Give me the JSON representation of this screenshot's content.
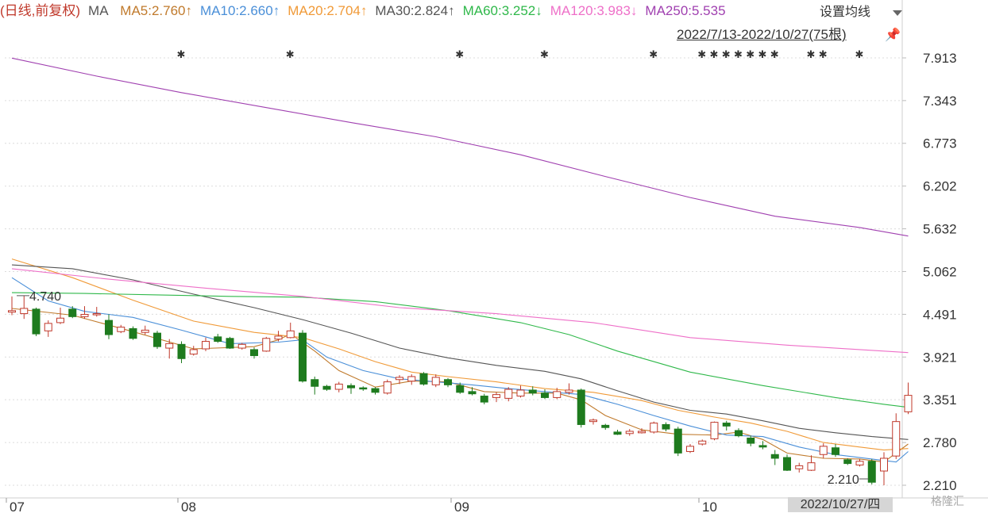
{
  "legend": {
    "title": "(日线,前复权)",
    "ma": "MA",
    "items": [
      {
        "label": "MA5:2.760↑",
        "color": "#c07a2c"
      },
      {
        "label": "MA10:2.660↑",
        "color": "#4a8fd8"
      },
      {
        "label": "MA20:2.704↑",
        "color": "#f09a38"
      },
      {
        "label": "MA30:2.824↑",
        "color": "#555555"
      },
      {
        "label": "MA60:3.252↓",
        "color": "#2fb84a"
      },
      {
        "label": "MA120:3.983↓",
        "color": "#ee6fc8"
      },
      {
        "label": "MA250:5.535",
        "color": "#a040b0"
      }
    ],
    "settings_label": "设置均线"
  },
  "range_label": "2022/7/13-2022/10/27(75根)",
  "date_box": "2022/10/27/四",
  "logo": "格隆汇",
  "chart_data": {
    "type": "candlestick",
    "y_ticks": [
      "7.913",
      "7.343",
      "6.773",
      "6.202",
      "5.632",
      "5.062",
      "4.491",
      "3.921",
      "3.351",
      "2.780",
      "2.210"
    ],
    "ylim": [
      2.21,
      7.913
    ],
    "x_ticks": [
      "07",
      "08",
      "09",
      "10"
    ],
    "annotations": [
      {
        "text": "4.740",
        "index": 0,
        "value": 4.74
      },
      {
        "text": "2.210",
        "index": 71,
        "value": 2.21
      }
    ],
    "event_markers": [
      14,
      23,
      37,
      44,
      53,
      57,
      58,
      59,
      60,
      61,
      62,
      63,
      66,
      67,
      70
    ],
    "candles": [
      [
        4.52,
        4.54,
        4.73,
        4.48
      ],
      [
        4.5,
        4.57,
        4.74,
        4.43
      ],
      [
        4.56,
        4.23,
        4.58,
        4.2
      ],
      [
        4.27,
        4.37,
        4.41,
        4.19
      ],
      [
        4.38,
        4.44,
        4.58,
        4.36
      ],
      [
        4.56,
        4.46,
        4.6,
        4.44
      ],
      [
        4.46,
        4.49,
        4.6,
        4.43
      ],
      [
        4.49,
        4.5,
        4.59,
        4.46
      ],
      [
        4.41,
        4.22,
        4.49,
        4.16
      ],
      [
        4.26,
        4.32,
        4.35,
        4.24
      ],
      [
        4.3,
        4.17,
        4.33,
        4.15
      ],
      [
        4.25,
        4.28,
        4.34,
        4.22
      ],
      [
        4.24,
        4.06,
        4.27,
        4.03
      ],
      [
        4.04,
        4.1,
        4.16,
        3.9
      ],
      [
        4.09,
        3.9,
        4.13,
        3.84
      ],
      [
        3.96,
        4.02,
        4.07,
        3.94
      ],
      [
        4.03,
        4.13,
        4.18,
        4.0
      ],
      [
        4.19,
        4.13,
        4.23,
        4.11
      ],
      [
        4.17,
        4.04,
        4.19,
        4.03
      ],
      [
        4.04,
        4.09,
        4.11,
        4.02
      ],
      [
        4.02,
        3.94,
        4.05,
        3.9
      ],
      [
        4.0,
        4.17,
        4.19,
        3.99
      ],
      [
        4.16,
        4.2,
        4.27,
        4.13
      ],
      [
        4.18,
        4.27,
        4.38,
        4.17
      ],
      [
        4.24,
        3.6,
        4.28,
        3.58
      ],
      [
        3.62,
        3.53,
        3.66,
        3.42
      ],
      [
        3.53,
        3.49,
        3.55,
        3.47
      ],
      [
        3.49,
        3.56,
        3.59,
        3.45
      ],
      [
        3.54,
        3.51,
        3.57,
        3.43
      ],
      [
        3.51,
        3.5,
        3.53,
        3.47
      ],
      [
        3.5,
        3.45,
        3.52,
        3.42
      ],
      [
        3.44,
        3.59,
        3.62,
        3.42
      ],
      [
        3.62,
        3.65,
        3.68,
        3.56
      ],
      [
        3.6,
        3.66,
        3.69,
        3.55
      ],
      [
        3.7,
        3.56,
        3.72,
        3.54
      ],
      [
        3.55,
        3.65,
        3.69,
        3.52
      ],
      [
        3.62,
        3.55,
        3.64,
        3.52
      ],
      [
        3.54,
        3.45,
        3.58,
        3.43
      ],
      [
        3.46,
        3.43,
        3.52,
        3.41
      ],
      [
        3.4,
        3.32,
        3.43,
        3.29
      ],
      [
        3.38,
        3.42,
        3.45,
        3.32
      ],
      [
        3.37,
        3.49,
        3.52,
        3.33
      ],
      [
        3.4,
        3.48,
        3.54,
        3.38
      ],
      [
        3.48,
        3.44,
        3.53,
        3.41
      ],
      [
        3.44,
        3.38,
        3.49,
        3.36
      ],
      [
        3.38,
        3.46,
        3.51,
        3.36
      ],
      [
        3.45,
        3.48,
        3.57,
        3.42
      ],
      [
        3.48,
        3.02,
        3.5,
        2.98
      ],
      [
        3.06,
        3.08,
        3.1,
        3.02
      ],
      [
        3.01,
        2.98,
        3.03,
        2.95
      ],
      [
        2.92,
        2.89,
        2.95,
        2.88
      ],
      [
        2.9,
        2.93,
        2.96,
        2.87
      ],
      [
        2.91,
        2.93,
        2.97,
        2.9
      ],
      [
        2.92,
        3.04,
        3.06,
        2.9
      ],
      [
        3.02,
        2.96,
        3.05,
        2.93
      ],
      [
        2.96,
        2.64,
        2.99,
        2.6
      ],
      [
        2.66,
        2.73,
        2.76,
        2.64
      ],
      [
        2.76,
        2.8,
        2.82,
        2.74
      ],
      [
        2.83,
        3.05,
        3.06,
        2.81
      ],
      [
        3.04,
        3.0,
        3.07,
        2.94
      ],
      [
        2.94,
        2.87,
        2.97,
        2.85
      ],
      [
        2.84,
        2.77,
        2.87,
        2.73
      ],
      [
        2.74,
        2.72,
        2.8,
        2.69
      ],
      [
        2.62,
        2.57,
        2.68,
        2.48
      ],
      [
        2.58,
        2.41,
        2.62,
        2.4
      ],
      [
        2.43,
        2.47,
        2.51,
        2.38
      ],
      [
        2.41,
        2.51,
        2.61,
        2.4
      ],
      [
        2.62,
        2.73,
        2.77,
        2.57
      ],
      [
        2.71,
        2.62,
        2.76,
        2.59
      ],
      [
        2.55,
        2.5,
        2.57,
        2.48
      ],
      [
        2.48,
        2.53,
        2.56,
        2.46
      ],
      [
        2.53,
        2.25,
        2.56,
        2.22
      ],
      [
        2.4,
        2.57,
        2.65,
        2.21
      ],
      [
        2.6,
        3.06,
        3.17,
        2.56
      ],
      [
        3.19,
        3.41,
        3.58,
        3.16
      ]
    ],
    "ma_lines": [
      {
        "name": "MA5",
        "color": "#c07a2c",
        "points": [
          [
            0,
            4.57
          ],
          [
            5,
            4.48
          ],
          [
            10,
            4.26
          ],
          [
            15,
            4.03
          ],
          [
            20,
            4.06
          ],
          [
            22,
            4.15
          ],
          [
            23,
            4.23
          ],
          [
            25,
            4.0
          ],
          [
            27,
            3.74
          ],
          [
            30,
            3.52
          ],
          [
            33,
            3.6
          ],
          [
            36,
            3.59
          ],
          [
            39,
            3.46
          ],
          [
            42,
            3.44
          ],
          [
            45,
            3.44
          ],
          [
            47,
            3.35
          ],
          [
            49,
            3.14
          ],
          [
            52,
            2.95
          ],
          [
            55,
            2.89
          ],
          [
            58,
            2.88
          ],
          [
            60,
            2.92
          ],
          [
            62,
            2.82
          ],
          [
            64,
            2.64
          ],
          [
            67,
            2.57
          ],
          [
            70,
            2.56
          ],
          [
            72,
            2.52
          ],
          [
            74,
            2.76
          ]
        ]
      },
      {
        "name": "MA10",
        "color": "#4a8fd8",
        "points": [
          [
            0,
            4.98
          ],
          [
            3,
            4.67
          ],
          [
            6,
            4.53
          ],
          [
            10,
            4.45
          ],
          [
            14,
            4.28
          ],
          [
            18,
            4.1
          ],
          [
            22,
            4.12
          ],
          [
            24,
            4.15
          ],
          [
            26,
            3.92
          ],
          [
            29,
            3.74
          ],
          [
            32,
            3.63
          ],
          [
            35,
            3.59
          ],
          [
            38,
            3.55
          ],
          [
            41,
            3.5
          ],
          [
            44,
            3.46
          ],
          [
            47,
            3.42
          ],
          [
            50,
            3.29
          ],
          [
            53,
            3.14
          ],
          [
            56,
            3.0
          ],
          [
            59,
            2.88
          ],
          [
            62,
            2.86
          ],
          [
            65,
            2.72
          ],
          [
            68,
            2.62
          ],
          [
            71,
            2.56
          ],
          [
            73,
            2.52
          ],
          [
            74,
            2.66
          ]
        ]
      },
      {
        "name": "MA20",
        "color": "#f09a38",
        "points": [
          [
            0,
            5.23
          ],
          [
            5,
            4.98
          ],
          [
            10,
            4.68
          ],
          [
            15,
            4.4
          ],
          [
            20,
            4.25
          ],
          [
            24,
            4.18
          ],
          [
            27,
            4.03
          ],
          [
            30,
            3.86
          ],
          [
            33,
            3.72
          ],
          [
            36,
            3.66
          ],
          [
            40,
            3.59
          ],
          [
            44,
            3.5
          ],
          [
            48,
            3.45
          ],
          [
            52,
            3.34
          ],
          [
            55,
            3.21
          ],
          [
            58,
            3.12
          ],
          [
            61,
            3.04
          ],
          [
            64,
            2.93
          ],
          [
            67,
            2.78
          ],
          [
            70,
            2.72
          ],
          [
            72,
            2.68
          ],
          [
            74,
            2.7
          ]
        ]
      },
      {
        "name": "MA30",
        "color": "#555555",
        "points": [
          [
            0,
            5.15
          ],
          [
            5,
            5.1
          ],
          [
            10,
            4.95
          ],
          [
            15,
            4.76
          ],
          [
            20,
            4.58
          ],
          [
            24,
            4.42
          ],
          [
            28,
            4.24
          ],
          [
            32,
            4.04
          ],
          [
            36,
            3.91
          ],
          [
            40,
            3.81
          ],
          [
            44,
            3.73
          ],
          [
            47,
            3.63
          ],
          [
            50,
            3.47
          ],
          [
            53,
            3.32
          ],
          [
            56,
            3.21
          ],
          [
            59,
            3.16
          ],
          [
            62,
            3.07
          ],
          [
            65,
            2.97
          ],
          [
            68,
            2.91
          ],
          [
            71,
            2.86
          ],
          [
            74,
            2.82
          ]
        ]
      },
      {
        "name": "MA60",
        "color": "#2fb84a",
        "points": [
          [
            0,
            4.78
          ],
          [
            6,
            4.77
          ],
          [
            12,
            4.75
          ],
          [
            18,
            4.73
          ],
          [
            24,
            4.72
          ],
          [
            30,
            4.66
          ],
          [
            36,
            4.54
          ],
          [
            42,
            4.38
          ],
          [
            46,
            4.22
          ],
          [
            50,
            4.0
          ],
          [
            56,
            3.72
          ],
          [
            62,
            3.54
          ],
          [
            68,
            3.38
          ],
          [
            72,
            3.29
          ],
          [
            74,
            3.25
          ]
        ]
      },
      {
        "name": "MA120",
        "color": "#ee6fc8",
        "points": [
          [
            0,
            5.1
          ],
          [
            8,
            4.96
          ],
          [
            16,
            4.84
          ],
          [
            24,
            4.73
          ],
          [
            32,
            4.58
          ],
          [
            40,
            4.5
          ],
          [
            48,
            4.38
          ],
          [
            56,
            4.18
          ],
          [
            64,
            4.08
          ],
          [
            70,
            4.02
          ],
          [
            74,
            3.98
          ]
        ]
      },
      {
        "name": "MA250",
        "color": "#a040b0",
        "points": [
          [
            0,
            7.91
          ],
          [
            7,
            7.67
          ],
          [
            14,
            7.45
          ],
          [
            21,
            7.25
          ],
          [
            28,
            7.05
          ],
          [
            35,
            6.86
          ],
          [
            42,
            6.62
          ],
          [
            49,
            6.33
          ],
          [
            56,
            6.05
          ],
          [
            63,
            5.8
          ],
          [
            70,
            5.65
          ],
          [
            74,
            5.535
          ]
        ]
      }
    ]
  }
}
